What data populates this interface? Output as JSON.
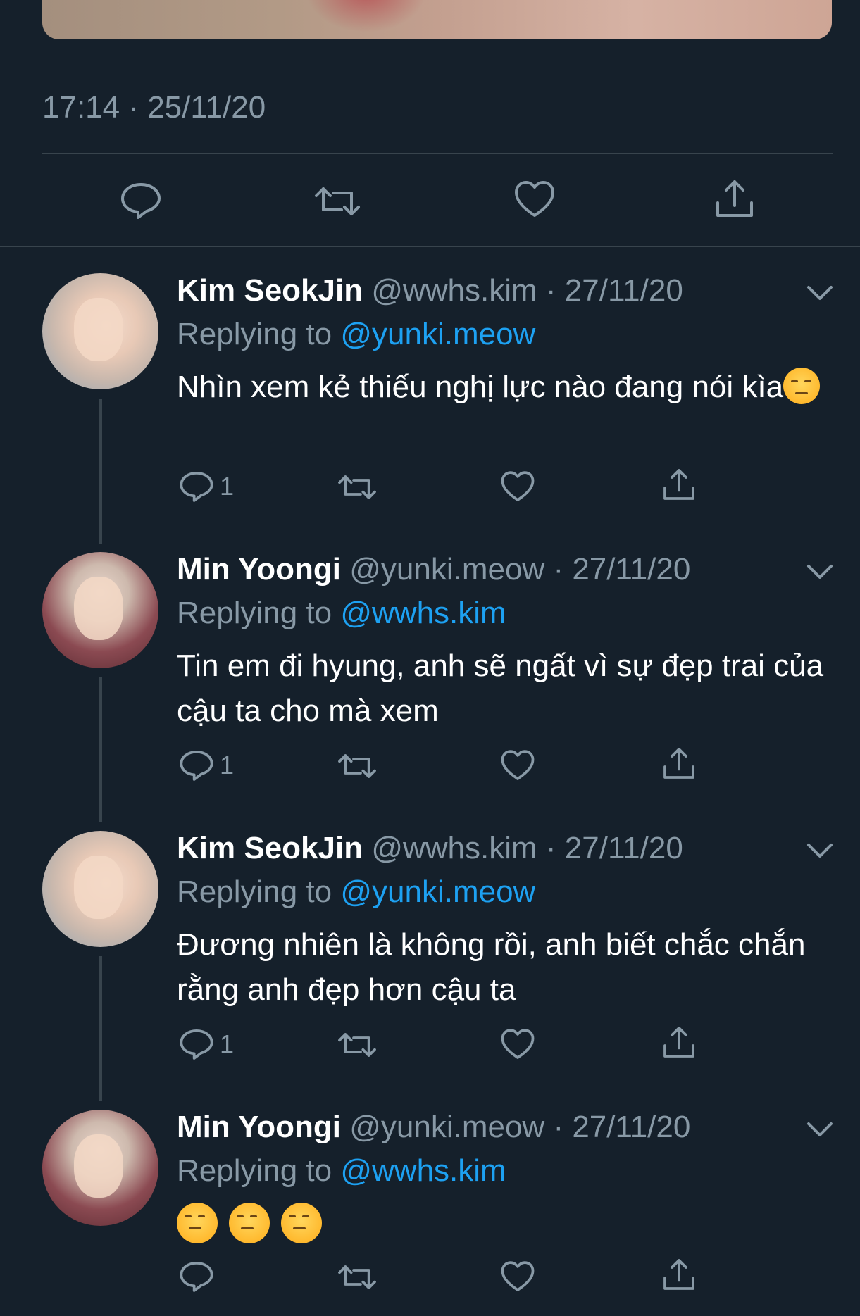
{
  "main_tweet": {
    "timestamp": "17:14 · 25/11/20"
  },
  "tweets": [
    {
      "name": "Kim SeokJin",
      "handle": "@wwhs.kim",
      "date": "· 27/11/20",
      "replying_prefix": "Replying to ",
      "replying_to": "@yunki.meow",
      "text": "Nhìn xem kẻ thiếu nghị lực nào đang nói kìa",
      "emojis": [
        "smirking-face"
      ],
      "reply_count": "1"
    },
    {
      "name": "Min Yoongi",
      "handle": "@yunki.meow",
      "date": "· 27/11/20",
      "replying_prefix": "Replying to ",
      "replying_to": "@wwhs.kim",
      "text": "Tin em đi hyung, anh sẽ ngất vì sự đẹp trai của cậu ta cho mà xem",
      "emojis": [],
      "reply_count": "1"
    },
    {
      "name": "Kim SeokJin",
      "handle": "@wwhs.kim",
      "date": "· 27/11/20",
      "replying_prefix": "Replying to ",
      "replying_to": "@yunki.meow",
      "text": "Đương nhiên là không rồi, anh biết chắc chắn rằng anh đẹp hơn cậu ta",
      "emojis": [],
      "reply_count": "1"
    },
    {
      "name": "Min Yoongi",
      "handle": "@yunki.meow",
      "date": "· 27/11/20",
      "replying_prefix": "Replying to ",
      "replying_to": "@wwhs.kim",
      "text": "",
      "emojis": [
        "unamused-face",
        "unamused-face",
        "unamused-face"
      ],
      "reply_count": ""
    }
  ],
  "icons": {
    "reply": "reply-icon",
    "retweet": "retweet-icon",
    "like": "heart-icon",
    "share": "share-icon",
    "more": "chevron-down-icon"
  },
  "colors": {
    "background": "#15202b",
    "secondary_text": "#8899a6",
    "link": "#1da1f2",
    "divider": "#38444d"
  }
}
